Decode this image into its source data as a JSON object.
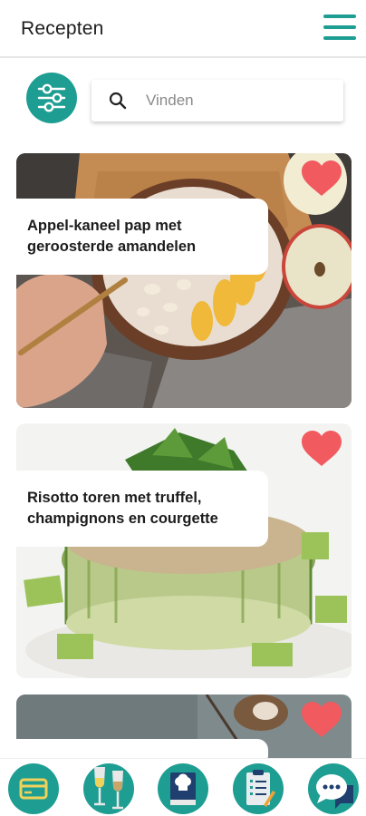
{
  "header": {
    "title": "Recepten"
  },
  "search": {
    "placeholder": "Vinden"
  },
  "recipes": [
    {
      "title_line1": "Appel-kaneel pap met",
      "title_line2": "geroosterde amandelen",
      "favorite": true
    },
    {
      "title_line1": "Risotto toren met truffel,",
      "title_line2": "champignons en courgette",
      "favorite": true
    },
    {
      "title_line1": "",
      "title_line2": "",
      "favorite": true
    }
  ],
  "colors": {
    "accent": "#1e9e92",
    "heart": "#f15a5f",
    "navy": "#1f3f6e"
  },
  "bottom_nav": [
    "card-icon",
    "wine-glasses-icon",
    "chef-cookbook-icon",
    "clipboard-list-icon",
    "chat-bubble-icon"
  ]
}
